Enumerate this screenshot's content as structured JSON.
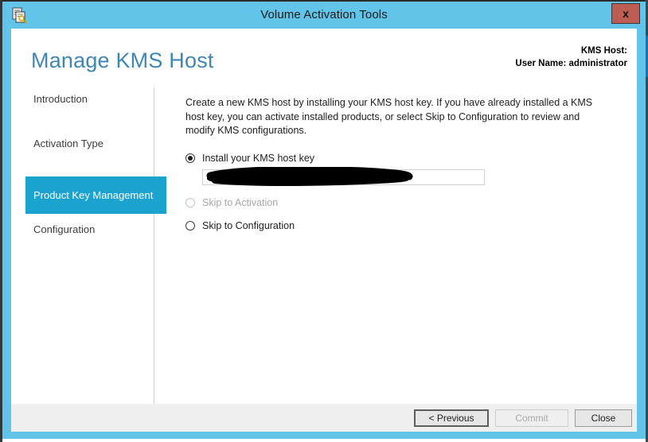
{
  "window": {
    "title": "Volume Activation Tools",
    "icon": "document-key-icon",
    "close_label": "x",
    "frame_color": "#62c4e8",
    "close_button_color": "#bd5c53"
  },
  "header": {
    "page_title": "Manage KMS Host",
    "page_title_color": "#3e87b5",
    "kms_host_label": "KMS Host:",
    "user_name_label": "User Name: administrator"
  },
  "sidebar": {
    "accent_color": "#1aa3cf",
    "items": [
      {
        "label": "Introduction",
        "active": false
      },
      {
        "label": "Activation Type",
        "active": false
      },
      {
        "label": "Product Key Management",
        "active": true
      },
      {
        "label": "Configuration",
        "active": false
      }
    ]
  },
  "main": {
    "description": "Create a new KMS host by installing your KMS host key. If you have already installed a KMS host key, you can activate installed products, or select Skip to Configuration to review and modify KMS configurations.",
    "options": [
      {
        "label": "Install your KMS host key",
        "selected": true,
        "disabled": false
      },
      {
        "label": "Skip to Activation",
        "selected": false,
        "disabled": true
      },
      {
        "label": "Skip to Configuration",
        "selected": false,
        "disabled": false
      }
    ],
    "key_input": {
      "value": "",
      "placeholder": "",
      "redacted": true
    }
  },
  "footer": {
    "buttons": [
      {
        "label": "< Previous",
        "disabled": false,
        "focused": true
      },
      {
        "label": "Commit",
        "disabled": true,
        "focused": false
      },
      {
        "label": "Close",
        "disabled": false,
        "focused": false
      }
    ]
  }
}
